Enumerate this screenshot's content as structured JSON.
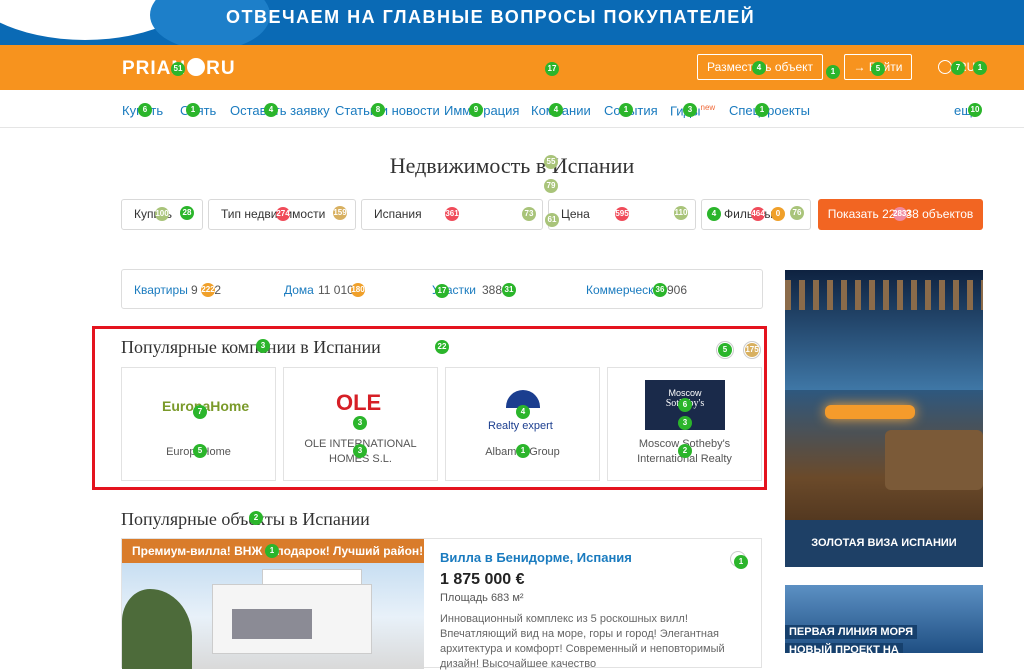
{
  "banner": {
    "text": "ОТВЕЧАЕМ НА ГЛАВНЫЕ ВОПРОСЫ ПОКУПАТЕЛЕЙ"
  },
  "header": {
    "logo_left": "PRIAN",
    "logo_right": "RU",
    "post_label": "Разместить объект",
    "login_label": "→ Войти",
    "lang_label": "RU"
  },
  "nav": {
    "items": [
      {
        "label": "Купить"
      },
      {
        "label": "Снять"
      },
      {
        "label": "Оставить заявку"
      },
      {
        "label": "Статьи и новости"
      },
      {
        "label": "Иммиграция"
      },
      {
        "label": "Компании"
      },
      {
        "label": "События"
      },
      {
        "label": "Гиды",
        "badge": "new"
      },
      {
        "label": "Спецпроекты"
      }
    ],
    "more_label": "ещё"
  },
  "page": {
    "title": "Недвижимость в Испании"
  },
  "filters": {
    "deal": "Купить",
    "type": "Тип недвижимости",
    "country": "Испания",
    "price": "Цена",
    "more": "Фильтры",
    "show_button": "Показать 22 538 объектов"
  },
  "categories": [
    {
      "label": "Квартиры",
      "count": "9 922"
    },
    {
      "label": "Дома",
      "count": "11 010"
    },
    {
      "label": "Участки",
      "count": "388"
    },
    {
      "label": "Коммерческая",
      "count": "906"
    }
  ],
  "companies": {
    "title": "Популярные компании в Испании",
    "items": [
      {
        "name": "EuropaHome",
        "logo": "EuropaHome"
      },
      {
        "name": "OLE INTERNATIONAL HOMES S.L.",
        "logo": "OLE"
      },
      {
        "name": "Albamar Group",
        "logo": "Realty expert"
      },
      {
        "name": "Moscow Sotheby's International Realty",
        "logo_line1": "Moscow",
        "logo_line2": "Sotheby's"
      }
    ]
  },
  "objects": {
    "title": "Популярные объекты в Испании",
    "listing": {
      "promo": "Премиум-вилла! ВНЖ в подарок! Лучший район!",
      "title": "Вилла в Бенидорме, Испания",
      "price": "1 875 000 €",
      "area": "Площадь 683 м²",
      "description": "Инновационный комплекс из 5 роскошных вилл! Впечатляющий вид на море, горы и город! Элегантная архитектура и комфорт! Современный и неповторимый дизайн! Высочайшее качество"
    }
  },
  "sidebar": {
    "promo1_caption": "ЗОЛОТАЯ ВИЗА ИСПАНИИ",
    "promo2_line1": "ПЕРВАЯ ЛИНИЯ МОРЯ",
    "promo2_line2": "НОВЫЙ ПРОЕКТ НА"
  },
  "markers": [
    "51",
    "17",
    "4",
    "1",
    "5",
    "7",
    "1",
    "6",
    "1",
    "4",
    "8",
    "9",
    "4",
    "1",
    "3",
    "1",
    "10",
    "55",
    "79",
    "28",
    "100",
    "274",
    "159",
    "361",
    "73",
    "61",
    "595",
    "110",
    "4",
    "464",
    "0",
    "76",
    "2833",
    "17",
    "222",
    "180",
    "31",
    "36",
    "3",
    "22",
    "5",
    "175",
    "7",
    "5",
    "3",
    "3",
    "4",
    "1",
    "6",
    "3",
    "2",
    "2",
    "1",
    "1"
  ],
  "colors": {
    "orange": "#f7931e",
    "blue_link": "#1a7bbf",
    "cta": "#f26522",
    "highlight": "#e4131e"
  }
}
